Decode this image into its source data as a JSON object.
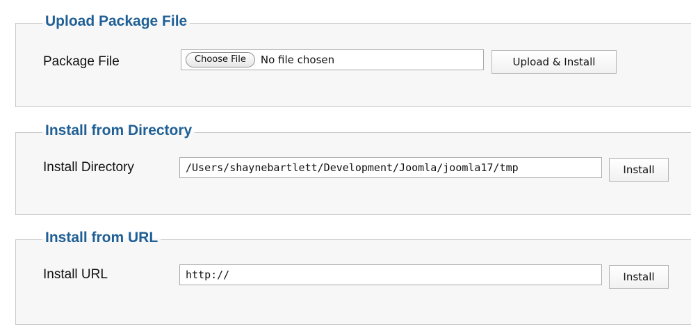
{
  "upload": {
    "legend": "Upload Package File",
    "label": "Package File",
    "choose_button": "Choose File",
    "file_status": "No file chosen",
    "submit_label": "Upload & Install"
  },
  "directory": {
    "legend": "Install from Directory",
    "label": "Install Directory",
    "value": "/Users/shaynebartlett/Development/Joomla/joomla17/tmp",
    "submit_label": "Install"
  },
  "url": {
    "legend": "Install from URL",
    "label": "Install URL",
    "value": "http://",
    "submit_label": "Install"
  },
  "colors": {
    "legend": "#1f5f95",
    "section_bg": "#f7f7f7",
    "border": "#c9c9c9"
  }
}
